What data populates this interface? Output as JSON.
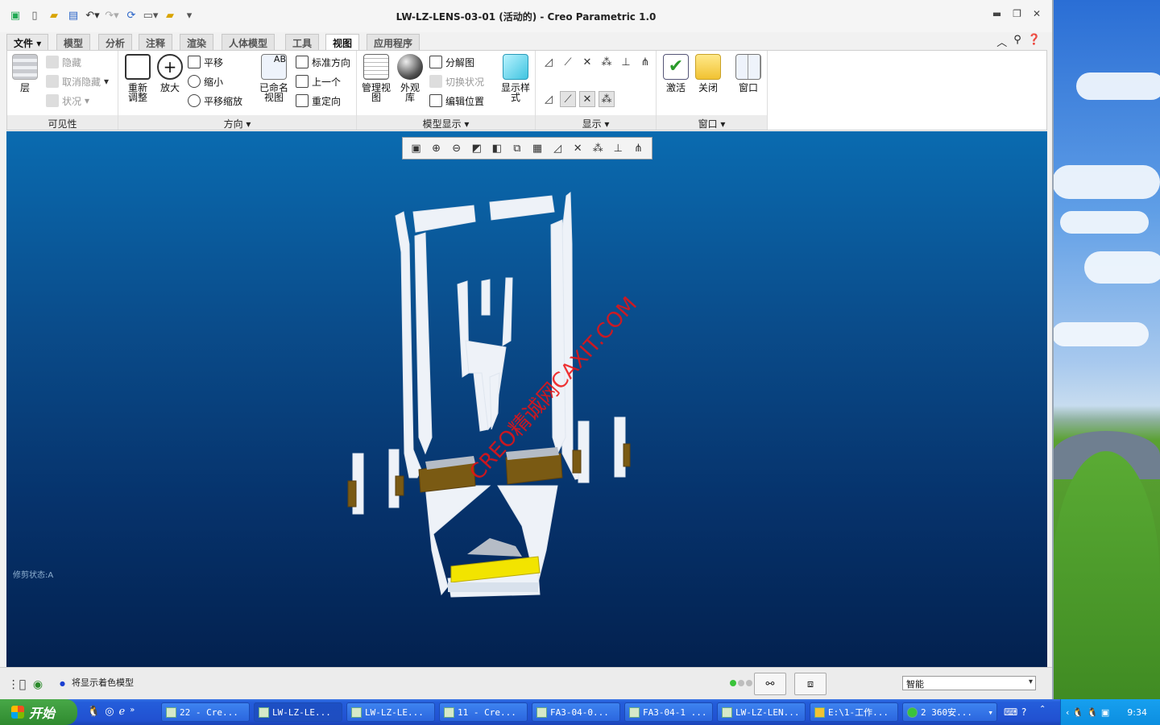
{
  "window": {
    "title": "LW-LZ-LENS-03-01 (活动的) - Creo Parametric 1.0",
    "controls": [
      "minimize-icon",
      "restore-icon",
      "close-icon"
    ]
  },
  "qat": [
    "creo-logo-icon",
    "new-icon",
    "open-icon",
    "save-icon",
    "undo-icon",
    "redo-icon",
    "regenerate-icon",
    "windows-icon",
    "close-window-icon",
    "customize-icon"
  ],
  "tabs": [
    {
      "label": "文件",
      "active": false
    },
    {
      "label": "模型",
      "active": false
    },
    {
      "label": "分析",
      "active": false
    },
    {
      "label": "注释",
      "active": false
    },
    {
      "label": "渲染",
      "active": false
    },
    {
      "label": "人体模型",
      "active": false
    },
    {
      "label": "工具",
      "active": false
    },
    {
      "label": "视图",
      "active": true
    },
    {
      "label": "应用程序",
      "active": false
    }
  ],
  "ribbon": {
    "visibility": {
      "label": "可见性",
      "layers": "层",
      "hide": "隐藏",
      "unhide": "取消隐藏",
      "status": "状况"
    },
    "orientation": {
      "label": "方向",
      "refit": "重新\n调整",
      "zoom_in": "放大",
      "pan": "平移",
      "zoom_out": "缩小",
      "pan_zoom": "平移缩放",
      "named_views": "已命名\n视图",
      "standard_orientation": "标准方向",
      "previous": "上一个",
      "reorient": "重定向"
    },
    "model_display": {
      "label": "模型显示",
      "manage_views": "管理视\n图",
      "appearance_gallery": "外观\n库",
      "exploded_view": "分解图",
      "toggle_status": "切换状况",
      "edit_position": "编辑位置",
      "display_style": "显示样\n式"
    },
    "show": {
      "label": "显示"
    },
    "window": {
      "label": "窗口",
      "activate": "激活",
      "close": "关闭",
      "windows": "窗口"
    }
  },
  "graphics": {
    "clip_state": "修剪状态:A",
    "watermark": "CREO精诚网CAXIT.COM"
  },
  "status_bar": {
    "message": "将显示着色模型",
    "filter": "智能"
  },
  "taskbar": {
    "start": "开始",
    "tasks": [
      {
        "label": "22 - Cre...",
        "active": false
      },
      {
        "label": "LW-LZ-LE...",
        "active": true
      },
      {
        "label": "LW-LZ-LE...",
        "active": false
      },
      {
        "label": "11 - Cre...",
        "active": false
      },
      {
        "label": "FA3-04-0...",
        "active": false
      },
      {
        "label": "FA3-04-1 ...",
        "active": false
      },
      {
        "label": "LW-LZ-LEN...",
        "active": false
      },
      {
        "label": "E:\\1-工作...",
        "active": false
      },
      {
        "label": "2 360安...",
        "active": false
      }
    ],
    "clock": "9:34"
  }
}
